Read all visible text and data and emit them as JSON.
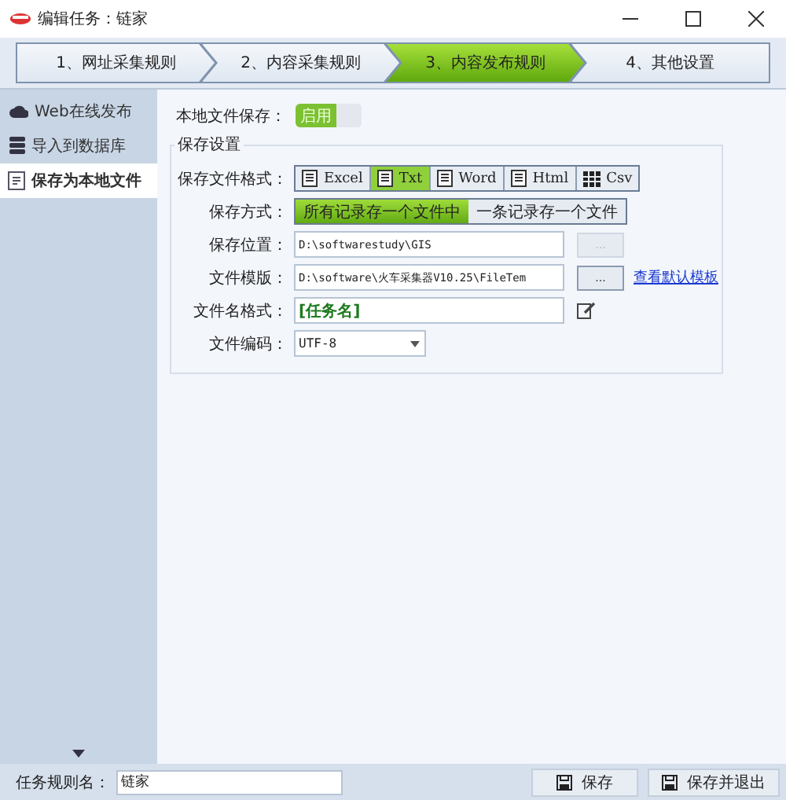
{
  "window": {
    "title": "编辑任务：链家"
  },
  "steps": [
    {
      "label": "1、网址采集规则",
      "selected": false
    },
    {
      "label": "2、内容采集规则",
      "selected": false
    },
    {
      "label": "3、内容发布规则",
      "selected": true
    },
    {
      "label": "4、其他设置",
      "selected": false
    }
  ],
  "sidebar": {
    "items": [
      {
        "label": "Web在线发布",
        "kind": "cloud",
        "selected": false
      },
      {
        "label": "导入到数据库",
        "kind": "database",
        "selected": false
      },
      {
        "label": "保存为本地文件",
        "kind": "file",
        "selected": true
      }
    ]
  },
  "local_save": {
    "label": "本地文件保存：",
    "toggle_text": "启用",
    "on": true
  },
  "group": {
    "title": "保存设置",
    "format": {
      "label": "保存文件格式：",
      "options": [
        {
          "label": "Excel",
          "selected": false
        },
        {
          "label": "Txt",
          "selected": true
        },
        {
          "label": "Word",
          "selected": false
        },
        {
          "label": "Html",
          "selected": false
        },
        {
          "label": "Csv",
          "selected": false
        }
      ]
    },
    "mode": {
      "label": "保存方式：",
      "options": [
        {
          "label": "所有记录存一个文件中",
          "selected": true
        },
        {
          "label": "一条记录存一个文件",
          "selected": false
        }
      ]
    },
    "location": {
      "label": "保存位置：",
      "value": "D:\\softwarestudy\\GIS",
      "browse": "...",
      "disabled": true
    },
    "template": {
      "label": "文件模版：",
      "value": "D:\\software\\火车采集器V10.25\\FileTem",
      "browse": "...",
      "link": "查看默认模板"
    },
    "filename": {
      "label": "文件名格式：",
      "value": "[任务名]"
    },
    "encoding": {
      "label": "文件编码：",
      "value": "UTF-8"
    }
  },
  "footer": {
    "label": "任务规则名：",
    "value": "链家",
    "buttons": [
      "保存",
      "保存并退出"
    ]
  }
}
